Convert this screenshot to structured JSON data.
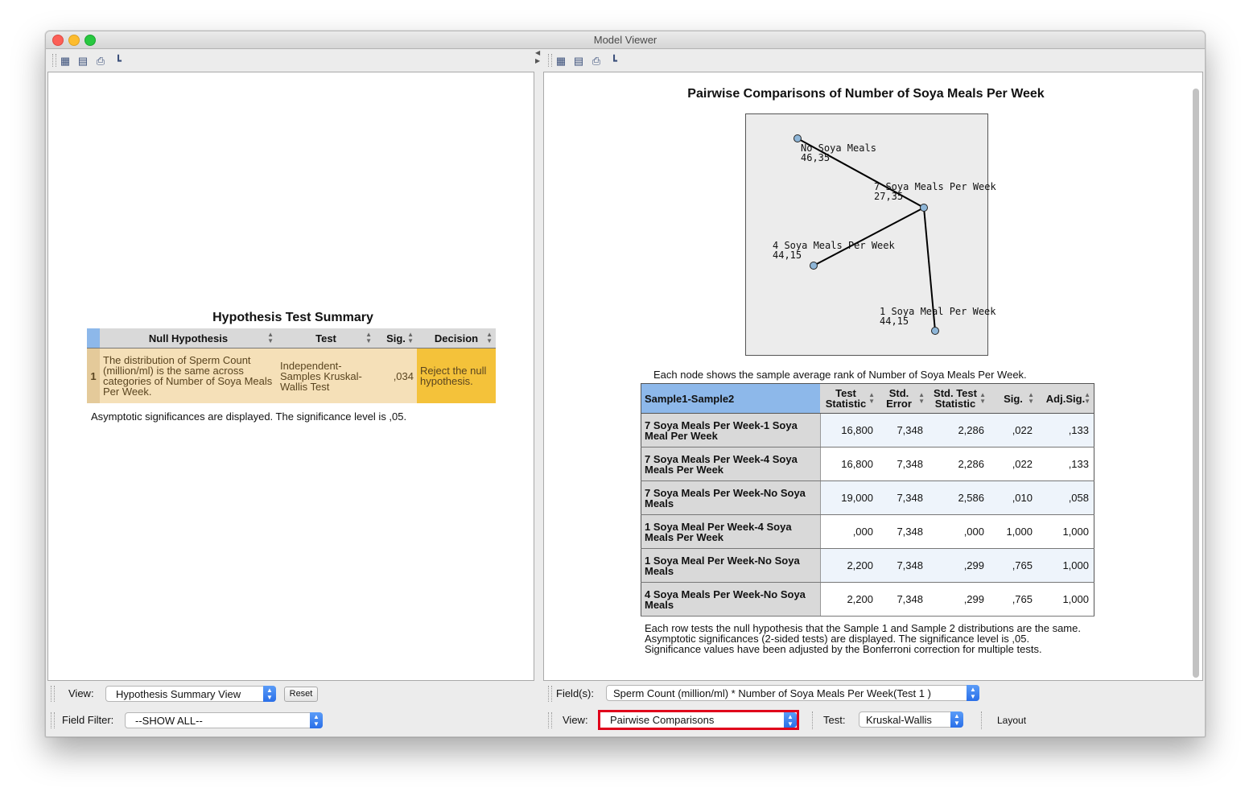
{
  "window": {
    "title": "Model Viewer"
  },
  "toolbar": {
    "icons": [
      "copy-chart-icon",
      "copy-data-icon",
      "print-icon",
      "tree-icon"
    ]
  },
  "left": {
    "summary_title": "Hypothesis Test Summary",
    "columns": [
      "Null Hypothesis",
      "Test",
      "Sig.",
      "Decision"
    ],
    "row": {
      "num": "1",
      "null_hypothesis": "The distribution of Sperm Count (million/ml) is the same across categories of Number of Soya Meals Per Week.",
      "test": "Independent-Samples Kruskal-Wallis Test",
      "sig": ",034",
      "decision": "Reject the null hypothesis."
    },
    "note": "Asymptotic significances are displayed.  The significance level is ,05.",
    "view_label": "View:",
    "view_value": "Hypothesis Summary View",
    "reset_label": "Reset",
    "filter_label": "Field Filter:",
    "filter_value": "--SHOW ALL--"
  },
  "right": {
    "title": "Pairwise Comparisons of Number of Soya Meals Per Week",
    "nodes": [
      {
        "name": "No Soya Meals",
        "value": "46,35"
      },
      {
        "name": "7 Soya Meals Per Week",
        "value": "27,35"
      },
      {
        "name": "4 Soya Meals Per Week",
        "value": "44,15"
      },
      {
        "name": "1 Soya Meal Per Week",
        "value": "44,15"
      }
    ],
    "caption": "Each node shows the sample average rank of Number of Soya Meals Per Week.",
    "table": {
      "headers": [
        "Sample1-Sample2",
        "Test Statistic",
        "Std. Error",
        "Std. Test Statistic",
        "Sig.",
        "Adj.Sig."
      ],
      "rows": [
        {
          "pair": "7 Soya Meals Per Week-1 Soya Meal Per Week",
          "ts": "16,800",
          "se": "7,348",
          "sts": "2,286",
          "sig": ",022",
          "adj": ",133"
        },
        {
          "pair": "7 Soya Meals Per Week-4 Soya Meals Per Week",
          "ts": "16,800",
          "se": "7,348",
          "sts": "2,286",
          "sig": ",022",
          "adj": ",133"
        },
        {
          "pair": "7 Soya Meals Per Week-No Soya Meals",
          "ts": "19,000",
          "se": "7,348",
          "sts": "2,586",
          "sig": ",010",
          "adj": ",058"
        },
        {
          "pair": "1 Soya Meal Per Week-4 Soya Meals Per Week",
          "ts": ",000",
          "se": "7,348",
          "sts": ",000",
          "sig": "1,000",
          "adj": "1,000"
        },
        {
          "pair": "1 Soya Meal Per Week-No Soya Meals",
          "ts": "2,200",
          "se": "7,348",
          "sts": ",299",
          "sig": ",765",
          "adj": "1,000"
        },
        {
          "pair": "4 Soya Meals Per Week-No Soya Meals",
          "ts": "2,200",
          "se": "7,348",
          "sts": ",299",
          "sig": ",765",
          "adj": "1,000"
        }
      ]
    },
    "footnotes": [
      "Each row tests the null hypothesis that the Sample 1 and Sample 2 distributions are the same.",
      "Asymptotic significances (2-sided tests) are displayed. The significance level is ,05.",
      "Significance values have been adjusted by the Bonferroni correction for multiple tests."
    ],
    "fields_label": "Field(s):",
    "fields_value": "Sperm Count (million/ml) * Number of Soya Meals Per Week(Test 1 )",
    "view_label": "View:",
    "view_value": "Pairwise Comparisons",
    "test_label": "Test:",
    "test_value": "Kruskal-Wallis",
    "layout_label": "Layout",
    "highlight_color": "#e0001b"
  }
}
